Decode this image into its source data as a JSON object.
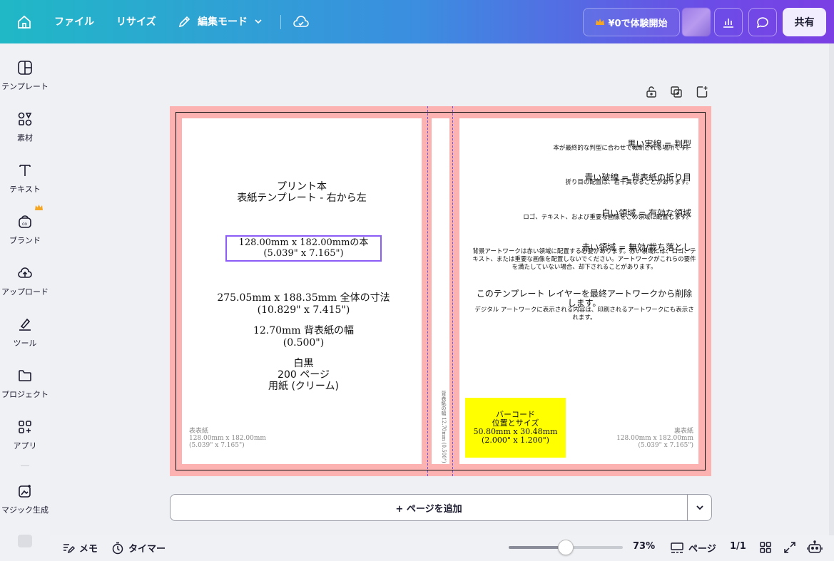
{
  "topbar": {
    "file_label": "ファイル",
    "resize_label": "リサイズ",
    "edit_mode_label": "編集モード",
    "trial_label": "¥0で体験開始",
    "share_label": "共有"
  },
  "sidebar": {
    "items": [
      {
        "label": "テンプレート",
        "icon": "template-icon"
      },
      {
        "label": "素材",
        "icon": "elements-icon"
      },
      {
        "label": "テキスト",
        "icon": "text-icon"
      },
      {
        "label": "ブランド",
        "icon": "brand-icon"
      },
      {
        "label": "アップロード",
        "icon": "upload-icon"
      },
      {
        "label": "ツール",
        "icon": "tools-icon"
      },
      {
        "label": "プロジェクト",
        "icon": "folder-icon"
      },
      {
        "label": "アプリ",
        "icon": "apps-icon"
      },
      {
        "label": "マジック生成",
        "icon": "magic-icon"
      }
    ]
  },
  "cover": {
    "front": {
      "title_line1": "プリント本",
      "title_line2": "表紙テンプレート - 右から左",
      "book_size_line1": "128.00mm x 182.00mmの本",
      "book_size_line2": "(5.039\" x 7.165\")",
      "full_size_line1": "275.05mm x 188.35mm 全体の寸法",
      "full_size_line2": "(10.829\" x 7.415\")",
      "spine_width_line1": "12.70mm 背表紙の幅",
      "spine_width_line2": "(0.500\")",
      "ink_line": "白黒",
      "pages_line": "200 ページ",
      "paper_line": "用紙 (クリーム)",
      "corner_label": "表表紙",
      "corner_mm": "128.00mm x 182.00mm",
      "corner_in": "(5.039\" x 7.165\")"
    },
    "spine_text": "背表紙の幅 12.70mm (0.500\")",
    "back": {
      "notes": [
        {
          "head": "黒い実線 = 判型",
          "body": "本が最終的な判型に合わせて裁断される場所です。"
        },
        {
          "head": "青い破線 = 背表紙の折り目",
          "body": "折り目の配置は、若干異なることがあります。"
        },
        {
          "head": "白い領域 = 有効な領域",
          "body": "ロゴ、テキスト、および重要な画像をこの領域に配置します。"
        },
        {
          "head": "赤い領域 = 無効/裁ち落とし",
          "body": "背景アートワークは赤い領域に配置する必要があります。赤い領域には、ロゴ、テキスト、または重要な画像を配置しないでください。アートワークがこれらの要件を満たしていない場合、却下されることがあります。"
        },
        {
          "head": "このテンプレート レイヤーを最終アートワークから削除します。",
          "body": "デジタル アートワークに表示される内容は、印刷されるアートワークにも表示されます。"
        }
      ],
      "barcode_line1": "バーコード",
      "barcode_line2": "位置とサイズ",
      "barcode_line3": "50.80mm x 30.48mm",
      "barcode_line4": "(2.000\" x 1.200\")",
      "corner_label": "裏表紙",
      "corner_mm": "128.00mm x 182.00mm",
      "corner_in": "(5.039\" x 7.165\")"
    }
  },
  "add_page_label": "+ ページを追加",
  "bottombar": {
    "notes_label": "メモ",
    "timer_label": "タイマー",
    "zoom_value": 0.5,
    "zoom_label": "73%",
    "pages_label": "ページ",
    "page_count": "1/1"
  },
  "colors": {
    "bleed": "#fbb2b1",
    "guide": "#6a55e0",
    "barcode": "#ffff00",
    "accent": "#8b5cf6"
  }
}
